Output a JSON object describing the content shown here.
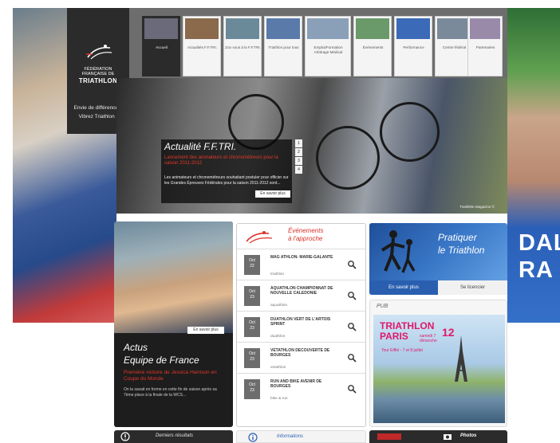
{
  "brand": {
    "line1": "FÉDÉRATION",
    "line2": "FRANÇAISE DE",
    "name": "TRIATHLON",
    "slogan_1": "Envie de différence ?",
    "slogan_2": "Vibrez Triathlon !"
  },
  "nav": {
    "items": [
      {
        "label": "Accueil",
        "thumb_color": "#6a6a7a",
        "active": true
      },
      {
        "label": "Actualités F.F.TRI.",
        "thumb_color": "#8a6a4a"
      },
      {
        "label": "Zoo vous à la F.F.TRI.",
        "thumb_color": "#6a8a9a"
      },
      {
        "label": "Triathlon pour tous",
        "thumb_color": "#5a7aaa"
      },
      {
        "label": "Emploi/Formation Arbitrage Médical",
        "thumb_color": "#8aa0b8"
      },
      {
        "label": "Événements",
        "thumb_color": "#6a9a6a"
      },
      {
        "label": "Performance",
        "thumb_color": "#3a6ab8"
      },
      {
        "label": "Centre fédéral",
        "thumb_color": "#7a8a9a"
      },
      {
        "label": "Partenaires",
        "thumb_color": "#9a8aaa"
      }
    ]
  },
  "hero": {
    "title": "Actualité F.F.TRI.",
    "red_text": "Lancement des animateurs et chronométreurs pour la saison 2011-2012",
    "body": "Les animateurs et chronométreurs souhaitant postuler pour officier sur les Grandes Épreuves Fédérales pour la saison 2011-2012 sont...",
    "more_label": "En savoir plus",
    "pages": [
      "1",
      "2",
      "3",
      "4"
    ],
    "credit": "Triathlète Magazine ©"
  },
  "news": {
    "more_label": "En savoir plus",
    "title_1": "Actus",
    "title_2": "Equipe de France",
    "red_text": "Première victoire de Jessica Harrison en Coupe du Monde",
    "body": "On la savait en forme en cette fin de saison après sa 7ème place à la finale de la WCS..."
  },
  "events": {
    "title_1": "Événements",
    "title_2": "à l'approche",
    "items": [
      {
        "month": "Oct",
        "day": "22",
        "name": "MAG ATHLON- MARIE-GALANTE",
        "sport": "triathlon"
      },
      {
        "month": "Oct",
        "day": "23",
        "name": "AQUATHLON CHAMPIONNAT DE NOUVELLE CALEDONIE",
        "sport": "aquathlon"
      },
      {
        "month": "Oct",
        "day": "23",
        "name": "DUATHLON VERT DE L'ARTOIS SPRINT",
        "sport": "duathlon"
      },
      {
        "month": "Oct",
        "day": "23",
        "name": "VETATHLON DECOUVERTE DE BOURGES",
        "sport": "vetathlon"
      },
      {
        "month": "Oct",
        "day": "23",
        "name": "RUN AND BIKE AVENIR DE BOURGES",
        "sport": "bike & run"
      }
    ]
  },
  "pratique": {
    "title_1": "Pratiquer",
    "title_2": "le Triathlon",
    "more_label": "En savoir plus",
    "license_label": "Se licencier"
  },
  "pub": {
    "label": "PUB",
    "tri": "TRIATHLON",
    "paris": "PARIS",
    "date_1": "samedi 7",
    "date_2": "dimanche",
    "num": "12",
    "sub": "Tour Eiffel - 7 et 8 juillet"
  },
  "bottom": {
    "results": "Derniers résultats",
    "info": "Informations",
    "photos": "Photos"
  },
  "bg_text": {
    "line1": "DAL",
    "line2": "RA"
  }
}
